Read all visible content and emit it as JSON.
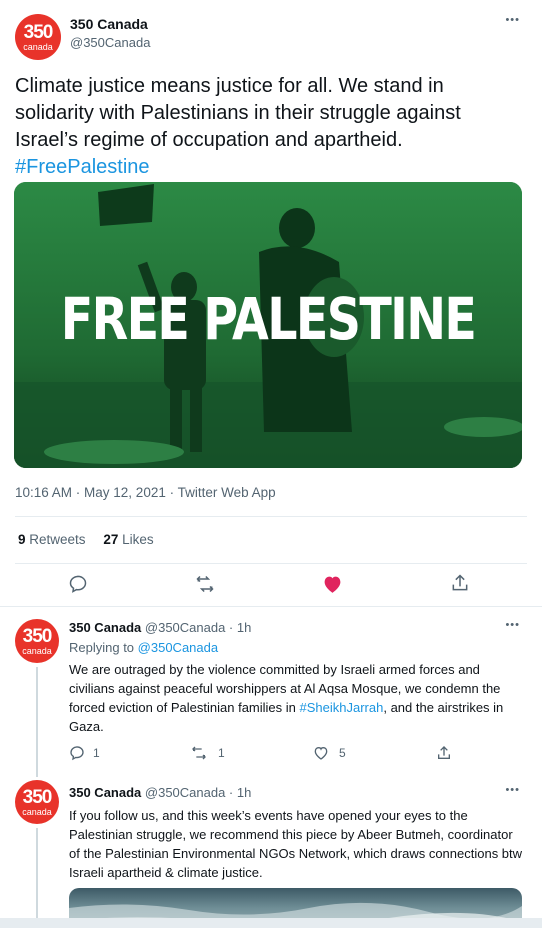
{
  "main_tweet": {
    "author_name": "350 Canada",
    "author_handle": "@350Canada",
    "avatar_num": "350",
    "avatar_sub": "canada",
    "text": "Climate justice means justice for all. We stand in solidarity with Palestinians in their struggle against Israel’s regime of occupation and apartheid.",
    "hashtag": "#FreePalestine",
    "image_caption": "FREE PALESTINE",
    "timestamp": "10:16 AM · May 12, 2021 · Twitter Web App",
    "retweets_count": "9",
    "retweets_label": "Retweets",
    "likes_count": "27",
    "likes_label": "Likes"
  },
  "replies": [
    {
      "author_name": "350 Canada",
      "handle_time": "@350Canada · 1h",
      "replying_prefix": "Replying to",
      "replying_to": "@350Canada",
      "text_before": "We are outraged by the violence committed by Israeli armed forces and civilians against peaceful worshippers at Al Aqsa Mosque, we condemn the forced eviction of Palestinian families in",
      "hashtag": "#SheikhJarrah",
      "text_after": ", and the airstrikes in Gaza.",
      "reply_count": "1",
      "retweet_count": "1",
      "like_count": "5"
    },
    {
      "author_name": "350 Canada",
      "handle_time": "@350Canada · 1h",
      "text": "If you follow us, and this week’s events have opened your eyes to the Palestinian struggle, we recommend this piece by Abeer Butmeh, coordinator of the Palestinian Environmental NGOs Network, which draws connections btw Israeli apartheid & climate justice."
    }
  ],
  "colors": {
    "accent": "#1b95e0",
    "like": "#e0245e",
    "brand": "#e8332a",
    "image_green": "#1f6b34"
  },
  "more_icon": "•••"
}
